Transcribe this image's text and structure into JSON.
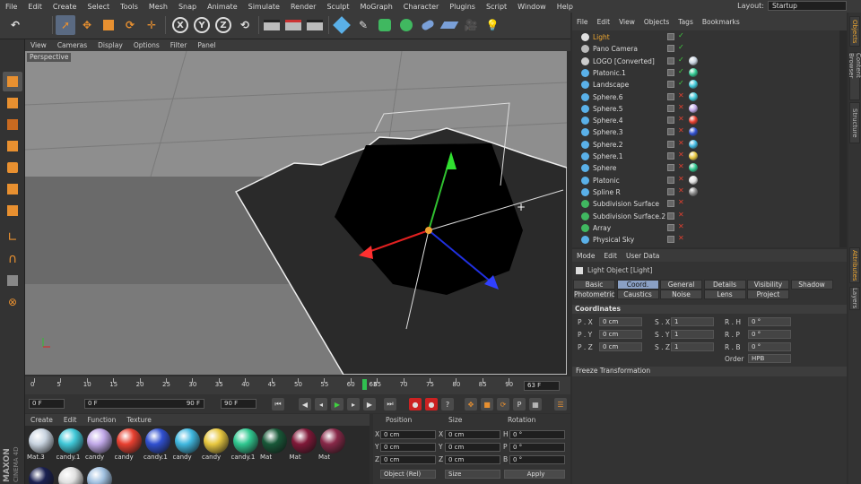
{
  "menubar": {
    "items": [
      "File",
      "Edit",
      "Create",
      "Select",
      "Tools",
      "Mesh",
      "Snap",
      "Animate",
      "Simulate",
      "Render",
      "Sculpt",
      "MoGraph",
      "Character",
      "Plugins",
      "Script",
      "Window",
      "Help"
    ],
    "layout_label": "Layout:",
    "layout_value": "Startup"
  },
  "toolbar": {
    "axis_x": "X",
    "axis_y": "Y",
    "axis_z": "Z"
  },
  "viewport": {
    "menu": [
      "View",
      "Cameras",
      "Display",
      "Options",
      "Filter",
      "Panel"
    ],
    "label": "Perspective"
  },
  "timeline": {
    "ticks": [
      "0",
      "5",
      "10",
      "15",
      "20",
      "25",
      "30",
      "35",
      "40",
      "45",
      "50",
      "55",
      "60",
      "65",
      "70",
      "75",
      "80",
      "85",
      "90"
    ],
    "current_marker": "63",
    "end_field": "63 F"
  },
  "playback": {
    "start_field": "0 F",
    "min_field": "0 F",
    "max_field": "90 F",
    "end_field": "90 F"
  },
  "materials": {
    "menu": [
      "Create",
      "Edit",
      "Function",
      "Texture"
    ],
    "items": [
      {
        "label": "Mat.3",
        "color": "#c9d4e0"
      },
      {
        "label": "candy.1",
        "color": "#40c8d8"
      },
      {
        "label": "candy",
        "color": "#c0a8e8"
      },
      {
        "label": "candy",
        "color": "#e84030"
      },
      {
        "label": "candy.1",
        "color": "#3050d0"
      },
      {
        "label": "candy",
        "color": "#40b8e0"
      },
      {
        "label": "candy",
        "color": "#e8c840"
      },
      {
        "label": "candy.1",
        "color": "#30c890"
      },
      {
        "label": "Mat",
        "color": "#185838"
      },
      {
        "label": "Mat",
        "color": "#801838"
      },
      {
        "label": "Mat",
        "color": "#882848"
      }
    ]
  },
  "coordinates": {
    "headers": [
      "Position",
      "Size",
      "Rotation"
    ],
    "rows": [
      {
        "axis": "X",
        "pos": "0 cm",
        "size_axis": "X",
        "size": "0 cm",
        "rot_axis": "H",
        "rot": "0 °"
      },
      {
        "axis": "Y",
        "pos": "0 cm",
        "size_axis": "Y",
        "size": "0 cm",
        "rot_axis": "P",
        "rot": "0 °"
      },
      {
        "axis": "Z",
        "pos": "0 cm",
        "size_axis": "Z",
        "size": "0 cm",
        "rot_axis": "B",
        "rot": "0 °"
      }
    ],
    "mode_select": "Object (Rel)",
    "size_select": "Size",
    "apply_label": "Apply"
  },
  "object_manager": {
    "menu": [
      "File",
      "Edit",
      "View",
      "Objects",
      "Tags",
      "Bookmarks"
    ],
    "objects": [
      {
        "name": "Light",
        "indent": 0,
        "icon": "#e0e0e0",
        "highlight": true
      },
      {
        "name": "Pano Camera",
        "indent": 0,
        "icon": "#bbbbbb"
      },
      {
        "name": "LOGO [Converted]",
        "indent": 0,
        "icon": "#cccccc"
      },
      {
        "name": "Platonic.1",
        "indent": 1,
        "icon": "#5ab0e8"
      },
      {
        "name": "Landscape",
        "indent": 1,
        "icon": "#5ab0e8"
      },
      {
        "name": "Sphere.6",
        "indent": 1,
        "icon": "#5ab0e8"
      },
      {
        "name": "Sphere.5",
        "indent": 1,
        "icon": "#5ab0e8"
      },
      {
        "name": "Sphere.4",
        "indent": 1,
        "icon": "#5ab0e8"
      },
      {
        "name": "Sphere.3",
        "indent": 1,
        "icon": "#5ab0e8"
      },
      {
        "name": "Sphere.2",
        "indent": 1,
        "icon": "#5ab0e8"
      },
      {
        "name": "Sphere.1",
        "indent": 1,
        "icon": "#5ab0e8"
      },
      {
        "name": "Sphere",
        "indent": 1,
        "icon": "#5ab0e8"
      },
      {
        "name": "Platonic",
        "indent": 1,
        "icon": "#5ab0e8"
      },
      {
        "name": "Spline R",
        "indent": 1,
        "icon": "#5ab0e8"
      },
      {
        "name": "Subdivision Surface",
        "indent": 0,
        "icon": "#40b860"
      },
      {
        "name": "Subdivision Surface.2",
        "indent": 0,
        "icon": "#40b860"
      },
      {
        "name": "Array",
        "indent": 1,
        "icon": "#40b860"
      },
      {
        "name": "Physical Sky",
        "indent": 1,
        "icon": "#5ab0e8"
      }
    ]
  },
  "attributes": {
    "menu": [
      "Mode",
      "Edit",
      "User Data"
    ],
    "object_title": "Light Object [Light]",
    "tabs_row1": [
      "Basic",
      "Coord.",
      "General",
      "Details",
      "Visibility",
      "Shadow"
    ],
    "tabs_row2": [
      "Photometric",
      "Caustics",
      "Noise",
      "Lens",
      "Project"
    ],
    "active_tab": "Coord.",
    "section": "Coordinates",
    "props": [
      {
        "a": "P . X",
        "av": "0 cm",
        "b": "S . X",
        "bv": "1",
        "c": "R . H",
        "cv": "0 °"
      },
      {
        "a": "P . Y",
        "av": "0 cm",
        "b": "S . Y",
        "bv": "1",
        "c": "R . P",
        "cv": "0 °"
      },
      {
        "a": "P . Z",
        "av": "0 cm",
        "b": "S . Z",
        "bv": "1",
        "c": "R . B",
        "cv": "0 °"
      }
    ],
    "order_label": "Order",
    "order_value": "HPB",
    "freeze_label": "Freeze Transformation"
  },
  "side_tabs": [
    "Objects",
    "Content Browser",
    "Structure",
    "Attributes",
    "Layers"
  ]
}
